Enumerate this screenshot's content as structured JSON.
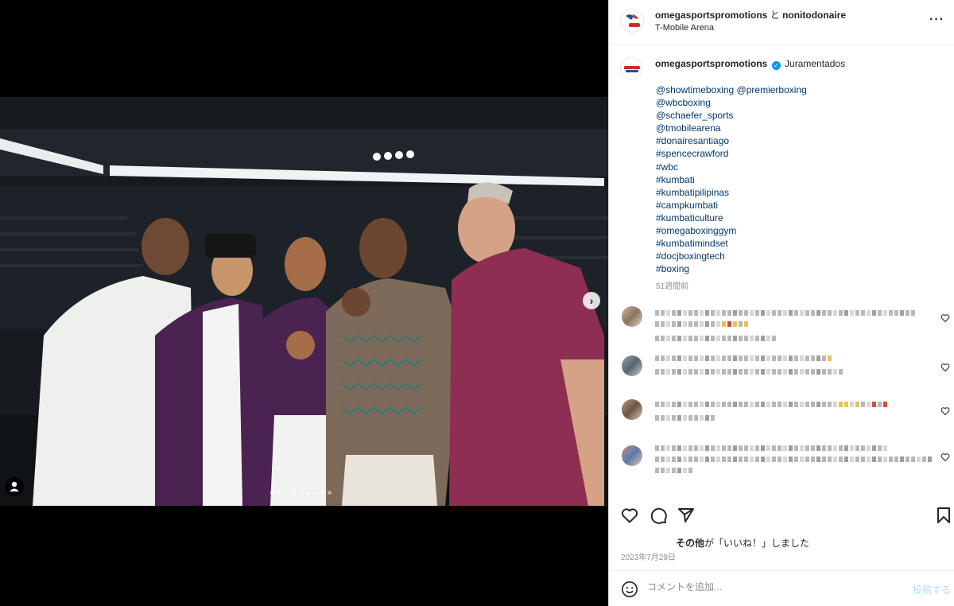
{
  "header": {
    "user1": "omegasportspromotions",
    "separator": "と",
    "user2": "nonitodonaire",
    "location": "T-Mobile Arena",
    "more_icon": "more-horizontal-icon"
  },
  "caption": {
    "username": "omegasportspromotions",
    "verified_icon": "verified-badge-icon",
    "text": "Juramentados",
    "tags": [
      "@showtimeboxing @premierboxing",
      "@wbcboxing",
      "@schaefer_sports",
      "@tmobilearena",
      "#donairesantiago",
      "#spencecrawford",
      "#wbc",
      "#kumbati",
      "#kumbatipilipinas",
      "#campkumbati",
      "#kumbaticulture",
      "#omegaboxinggym",
      "#kumbatimindset",
      "#docjboxingtech",
      "#boxing"
    ],
    "time_ago": "51週間前"
  },
  "media": {
    "carousel_total": 9,
    "carousel_active": 1,
    "next_icon": "chevron-right-icon",
    "tag_icon": "user-tag-icon"
  },
  "actions": {
    "like_icon": "heart-icon",
    "comment_icon": "comment-icon",
    "share_icon": "send-icon",
    "save_icon": "bookmark-icon"
  },
  "likes": {
    "bold": "その他",
    "rest": "が「いいね！」しました"
  },
  "date": "2023年7月29日",
  "comment_box": {
    "placeholder": "コメントを追加...",
    "post_label": "投稿する",
    "emoji_icon": "smiley-icon"
  },
  "colors": {
    "link": "#00376b",
    "muted": "#8e8e8e",
    "verified": "#0095f6",
    "post_disabled": "#b2dffc"
  }
}
